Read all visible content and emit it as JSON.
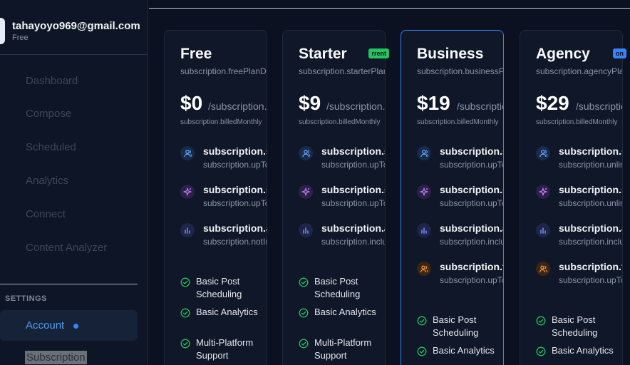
{
  "user": {
    "email": "tahayoyo969@gmail.com",
    "plan": "Free"
  },
  "sidebar": {
    "items": [
      {
        "label": "Dashboard"
      },
      {
        "label": "Compose"
      },
      {
        "label": "Scheduled"
      },
      {
        "label": "Analytics"
      },
      {
        "label": "Connect"
      },
      {
        "label": "Content Analyzer"
      }
    ],
    "settings_heading": "SETTINGS",
    "account_label": "Account",
    "subscription_label": "Subscription"
  },
  "plans": [
    {
      "name": "Free",
      "desc": "subscription.freePlanDescription",
      "price": "$0",
      "period": "/subscription.month",
      "billed": "subscription.billedMonthly",
      "badge": "",
      "features": [
        {
          "icon": "users-icon",
          "title": "subscription.socialAccounts",
          "sub": "subscription.upTo"
        },
        {
          "icon": "sparkles-icon",
          "title": "subscription.scheduledPosts",
          "sub": "subscription.upTo"
        },
        {
          "icon": "chart-icon",
          "title": "subscription.advancedAnalytics",
          "sub": "subscription.notIncluded"
        }
      ],
      "checks": [
        "Basic Post Scheduling",
        "Basic Analytics",
        "Multi-Platform Support"
      ]
    },
    {
      "name": "Starter",
      "desc": "subscription.starterPlanDescription",
      "price": "$9",
      "period": "/subscription.month",
      "billed": "subscription.billedMonthly",
      "badge": "rrent",
      "features": [
        {
          "icon": "users-icon",
          "title": "subscription.socialAccounts",
          "sub": "subscription.upTo"
        },
        {
          "icon": "sparkles-icon",
          "title": "subscription.scheduledPosts",
          "sub": "subscription.upTo"
        },
        {
          "icon": "chart-icon",
          "title": "subscription.advancedAnalytics",
          "sub": "subscription.included"
        }
      ],
      "checks": [
        "Basic Post Scheduling",
        "Basic Analytics",
        "Multi-Platform Support"
      ]
    },
    {
      "name": "Business",
      "desc": "subscription.businessPlanDescription",
      "price": "$19",
      "period": "/subscription.month",
      "billed": "subscription.billedMonthly",
      "badge": "",
      "features": [
        {
          "icon": "users-icon",
          "title": "subscription.socialAccounts",
          "sub": "subscription.upTo"
        },
        {
          "icon": "sparkles-icon",
          "title": "subscription.scheduledPosts",
          "sub": "subscription.upTo"
        },
        {
          "icon": "chart-icon",
          "title": "subscription.advancedAnalytics",
          "sub": "subscription.included"
        },
        {
          "icon": "team-icon",
          "title": "subscription.teamMembers",
          "sub": "subscription.upTo"
        }
      ],
      "checks": [
        "Basic Post Scheduling",
        "Basic Analytics"
      ]
    },
    {
      "name": "Agency",
      "desc": "subscription.agencyPlanDescription",
      "price": "$29",
      "period": "/subscription.month",
      "billed": "subscription.billedMonthly",
      "badge": "on",
      "features": [
        {
          "icon": "users-icon",
          "title": "subscription.socialAccounts",
          "sub": "subscription.unlimited"
        },
        {
          "icon": "sparkles-icon",
          "title": "subscription.scheduledPosts",
          "sub": "subscription.unlimited"
        },
        {
          "icon": "chart-icon",
          "title": "subscription.advancedAnalytics",
          "sub": "subscription.included"
        },
        {
          "icon": "team-icon",
          "title": "subscription.teamMembers",
          "sub": "subscription.upTo"
        }
      ],
      "checks": [
        "Basic Post Scheduling",
        "Basic Analytics"
      ]
    }
  ],
  "colors": {
    "accent": "#3b82f6",
    "current_badge": "#22c55e",
    "popular_badge": "#3b82f6",
    "check": "#22c55e",
    "users_icon": "#60a5fa",
    "sparkles_icon": "#c084fc",
    "chart_icon": "#818cf8",
    "team_icon": "#fb923c"
  }
}
